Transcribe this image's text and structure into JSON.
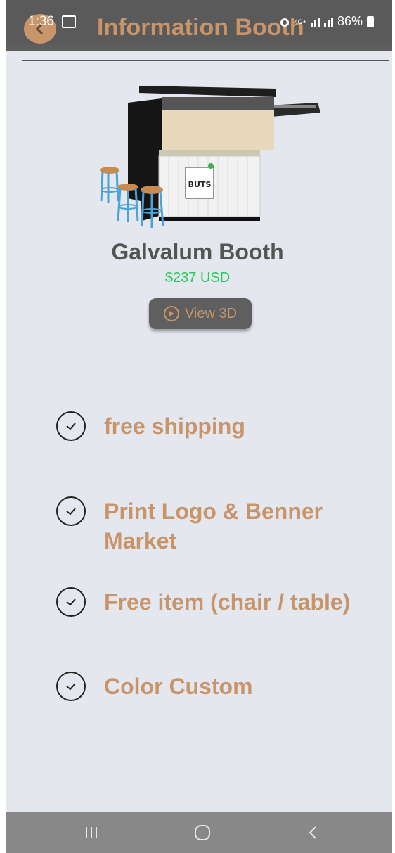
{
  "status_bar": {
    "time": "1:36",
    "network": "4G+",
    "battery": "86%"
  },
  "header": {
    "title": "Information Booth",
    "back_icon": "back-arrow-icon"
  },
  "product": {
    "name": "Galvalum Booth",
    "price": "$237 USD",
    "view_button_label": "View 3D",
    "view_button_icon": "play-circle-icon",
    "sign_text": "BUTS"
  },
  "features": [
    {
      "text": "free shipping",
      "icon": "check-circle-icon"
    },
    {
      "text": "Print Logo & Benner Market",
      "icon": "check-circle-icon"
    },
    {
      "text": "Free item (chair / table)",
      "icon": "check-circle-icon"
    },
    {
      "text": "Color Custom",
      "icon": "check-circle-icon"
    }
  ],
  "colors": {
    "accent": "#c8946a",
    "price": "#27c95c",
    "background": "#e5e7ef",
    "button": "#5f5f5f"
  },
  "nav_bar": {
    "recents_icon": "recents-icon",
    "home_icon": "home-icon",
    "back_icon": "back-chevron-icon"
  }
}
